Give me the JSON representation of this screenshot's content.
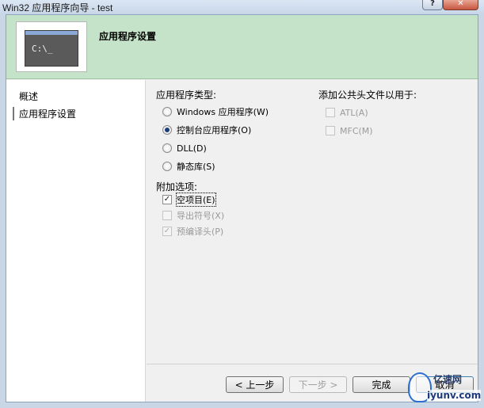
{
  "window": {
    "title": "Win32 应用程序向导 - test",
    "help_glyph": "?",
    "close_glyph": "✕"
  },
  "header": {
    "title": "应用程序设置",
    "image_prompt": "C:\\_"
  },
  "nav": {
    "items": [
      {
        "label": "概述",
        "selected": false
      },
      {
        "label": "应用程序设置",
        "selected": true
      }
    ]
  },
  "app_type": {
    "label": "应用程序类型:",
    "options": [
      {
        "label": "Windows 应用程序(W)",
        "selected": false
      },
      {
        "label": "控制台应用程序(O)",
        "selected": true
      },
      {
        "label": "DLL(D)",
        "selected": false
      },
      {
        "label": "静态库(S)",
        "selected": false
      }
    ]
  },
  "extra_options": {
    "label": "附加选项:",
    "items": [
      {
        "label": "空项目(E)",
        "checked": true,
        "enabled": true
      },
      {
        "label": "导出符号(X)",
        "checked": false,
        "enabled": false
      },
      {
        "label": "预编译头(P)",
        "checked": true,
        "enabled": false
      }
    ]
  },
  "common_headers": {
    "label": "添加公共头文件以用于:",
    "items": [
      {
        "label": "ATL(A)",
        "checked": false,
        "enabled": false
      },
      {
        "label": "MFC(M)",
        "checked": false,
        "enabled": false
      }
    ]
  },
  "buttons": {
    "prev": "< 上一步",
    "next": "下一步 >",
    "finish": "完成",
    "cancel": "取消"
  },
  "watermark": {
    "top": "亿速网",
    "bottom": "iyunv.com"
  }
}
